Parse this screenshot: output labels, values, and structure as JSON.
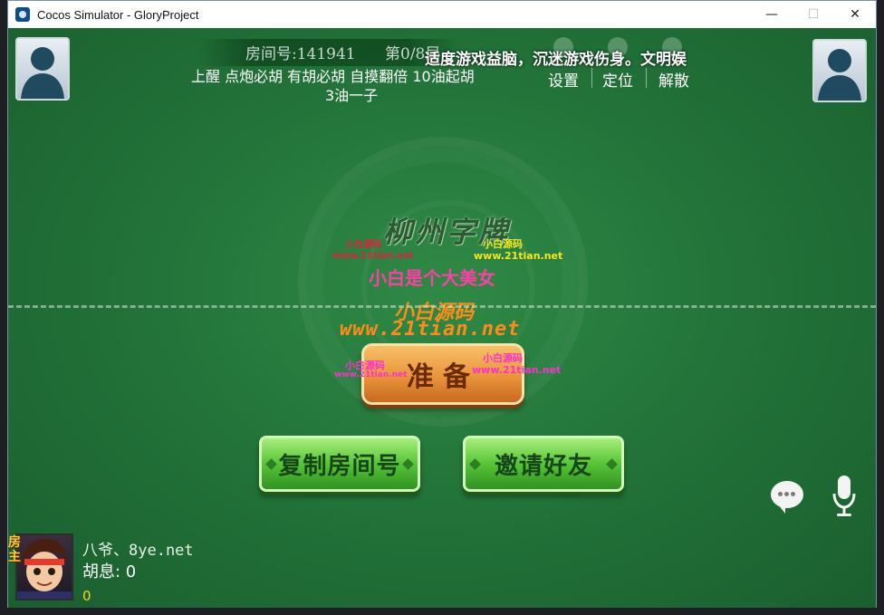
{
  "window": {
    "title": "Cocos Simulator - GloryProject",
    "minimize": "—",
    "maximize": "☐",
    "close": "✕"
  },
  "room": {
    "number_text": "房间号:141941",
    "round_text": "第0/8局",
    "rules_line1": "上醒  点炮必胡  有胡必胡  自摸翻倍  10油起胡",
    "rules_line2": "3油一子"
  },
  "notice": "适度游戏益脑，沉迷游戏伤身。文明娱",
  "top_menu": {
    "settings": "设置",
    "locate": "定位",
    "dissolve": "解散"
  },
  "watermarks": {
    "game_title": "柳州字牌",
    "small_red": "小白源码",
    "small_red_url": "www.21tian.net",
    "small_yellow": "小白源码",
    "small_yellow_url": "www.21tian.net",
    "pink_line": "小白是个大美女",
    "orange_line": "小白源码",
    "orange_url": "www.21tian.net",
    "magenta_left": "小白源码",
    "magenta_left_url": "www.21tian.net",
    "magenta_right": "小白源码",
    "magenta_right_url": "www.21tian.net"
  },
  "buttons": {
    "ready": "准备",
    "copy_room": "复制房间号",
    "invite": "邀请好友"
  },
  "player": {
    "host_badge": "房主",
    "name": "八爷、8ye.net",
    "huxi": "胡息: 0",
    "score": "0"
  },
  "icons": {
    "app": "cocos-icon",
    "settings": "gear-icon",
    "locate": "location-icon",
    "dissolve": "dissolve-icon",
    "chat": "chat-icon",
    "voice": "microphone-icon"
  },
  "colors": {
    "table_green": "#23743a",
    "ready_orange": "#e9943b",
    "button_green": "#57c437",
    "score_yellow": "#ffd21f"
  }
}
